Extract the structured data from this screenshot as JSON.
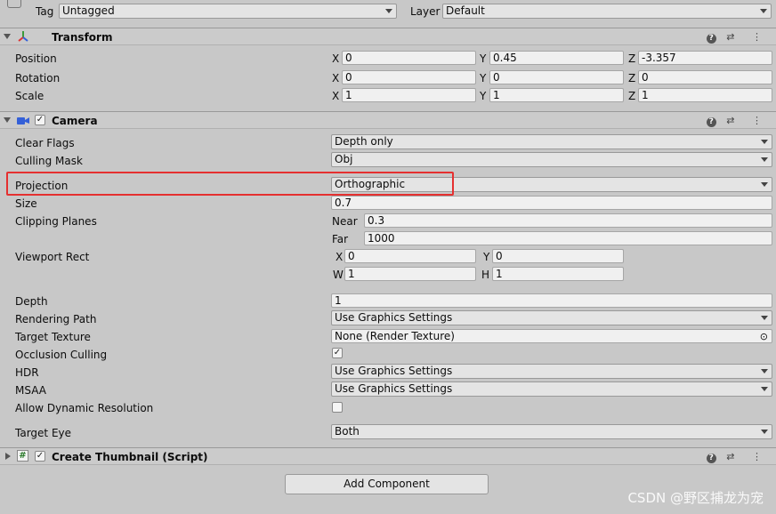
{
  "header_top": {
    "tag_label": "Tag",
    "tag_value": "Untagged",
    "layer_label": "Layer",
    "layer_value": "Default"
  },
  "transform": {
    "title": "Transform",
    "position": {
      "label": "Position",
      "x": "0",
      "y": "0.45",
      "z": "-3.357"
    },
    "rotation": {
      "label": "Rotation",
      "x": "0",
      "y": "0",
      "z": "0"
    },
    "scale": {
      "label": "Scale",
      "x": "1",
      "y": "1",
      "z": "1"
    },
    "axis_x": "X",
    "axis_y": "Y",
    "axis_z": "Z"
  },
  "camera": {
    "title": "Camera",
    "enabled": true,
    "clear_flags": {
      "label": "Clear Flags",
      "value": "Depth only"
    },
    "culling_mask": {
      "label": "Culling Mask",
      "value": "Obj"
    },
    "projection": {
      "label": "Projection",
      "value": "Orthographic"
    },
    "size": {
      "label": "Size",
      "value": "0.7"
    },
    "clipping_planes": {
      "label": "Clipping Planes",
      "near_label": "Near",
      "near": "0.3",
      "far_label": "Far",
      "far": "1000"
    },
    "viewport_rect": {
      "label": "Viewport Rect",
      "x_label": "X",
      "x": "0",
      "y_label": "Y",
      "y": "0",
      "w_label": "W",
      "w": "1",
      "h_label": "H",
      "h": "1"
    },
    "depth": {
      "label": "Depth",
      "value": "1"
    },
    "rendering_path": {
      "label": "Rendering Path",
      "value": "Use Graphics Settings"
    },
    "target_texture": {
      "label": "Target Texture",
      "value": "None (Render Texture)"
    },
    "occlusion_culling": {
      "label": "Occlusion Culling",
      "checked": true
    },
    "hdr": {
      "label": "HDR",
      "value": "Use Graphics Settings"
    },
    "msaa": {
      "label": "MSAA",
      "value": "Use Graphics Settings"
    },
    "allow_dynamic_resolution": {
      "label": "Allow Dynamic Resolution",
      "checked": false
    },
    "target_eye": {
      "label": "Target Eye",
      "value": "Both"
    }
  },
  "script_component": {
    "title": "Create Thumbnail (Script)",
    "enabled": true
  },
  "add_component_label": "Add Component",
  "watermark": "CSDN @野区捕龙为宠",
  "colors": {
    "highlight": "#e53030",
    "panel_bg": "#c8c8c8"
  }
}
